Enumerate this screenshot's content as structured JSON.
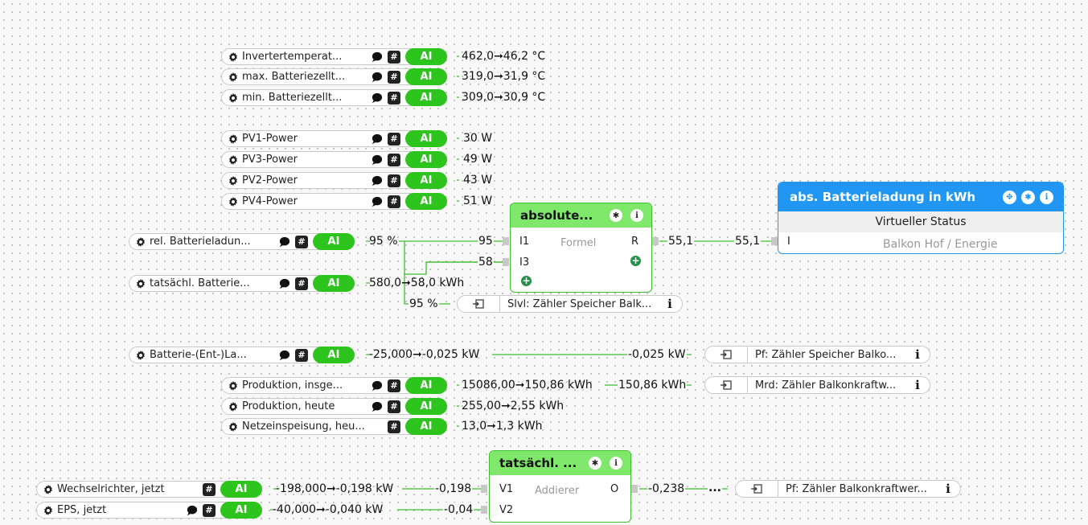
{
  "inputs": [
    {
      "label": "Invertertemperat...",
      "value": "462,0➞46,2 °C",
      "comment": true
    },
    {
      "label": "max. Batteriezellt...",
      "value": "319,0➞31,9 °C",
      "comment": true
    },
    {
      "label": "min. Batteriezellt...",
      "value": "309,0➞30,9 °C",
      "comment": true
    },
    {
      "label": "PV1-Power",
      "value": "30 W",
      "comment": true
    },
    {
      "label": "PV3-Power",
      "value": "49 W",
      "comment": true
    },
    {
      "label": "PV2-Power",
      "value": "43 W",
      "comment": true
    },
    {
      "label": "PV4-Power",
      "value": "51 W",
      "comment": true
    },
    {
      "label": "rel. Batterieladun...",
      "value": "95 %",
      "comment": true
    },
    {
      "label": "tatsächl. Batterie...",
      "value": "580,0➞58,0 kWh",
      "comment": true
    },
    {
      "label": "Batterie-(Ent-)La...",
      "value": "-25,000➞-0,025 kW",
      "comment": true
    },
    {
      "label": "Produktion, insge...",
      "value": "15086,00➞150,86 kWh",
      "comment": true
    },
    {
      "label": "Produktion, heute",
      "value": "255,00➞2,55 kWh",
      "comment": true
    },
    {
      "label": "Netzeinspeisung, heu...",
      "value": "13,0➞1,3 kWh",
      "comment": false
    },
    {
      "label": "Wechselrichter, jetzt",
      "value": "-198,000➞-0,198 kW",
      "comment": false
    },
    {
      "label": "EPS, jetzt",
      "value": "-40,000➞-0,040 kW",
      "comment": true
    }
  ],
  "ai_label": "AI",
  "hash_label": "#",
  "formula_block": {
    "title": "absolute...",
    "subtitle": "Formel",
    "pin_i1": "I1",
    "pin_i3": "I3",
    "pin_r": "R",
    "in1_value": "95",
    "in3_value": "58",
    "out_value": "55,1"
  },
  "virtual_status": {
    "title": "abs. Batterieladung in kWh",
    "type": "Virtueller Status",
    "pin": "I",
    "location": "Balkon Hof / Energie",
    "in_value": "55,1"
  },
  "adder_block": {
    "title": "tatsächl. ...",
    "subtitle": "Addierer",
    "pin_v1": "V1",
    "pin_v2": "V2",
    "pin_o": "O",
    "v1_value": "-0,198",
    "v2_value": "-0,04",
    "out_value": "-0,238",
    "ellipsis": "..."
  },
  "outputs": [
    {
      "label": "Slvl: Zähler Speicher Balk...",
      "in_value": "95 %"
    },
    {
      "label": "Pf: Zähler Speicher Balko...",
      "in_value": "-0,025 kW"
    },
    {
      "label": "Mrd: Zähler Balkonkraftw...",
      "in_value": "150,86 kWh"
    },
    {
      "label": "Pf: Zähler Balkonkraftwer...",
      "in_value": ""
    }
  ],
  "colors": {
    "ai_green": "#2ec41e",
    "block_header": "#7fe86a",
    "status_blue": "#2196f3",
    "wire": "#3dbf2e"
  }
}
